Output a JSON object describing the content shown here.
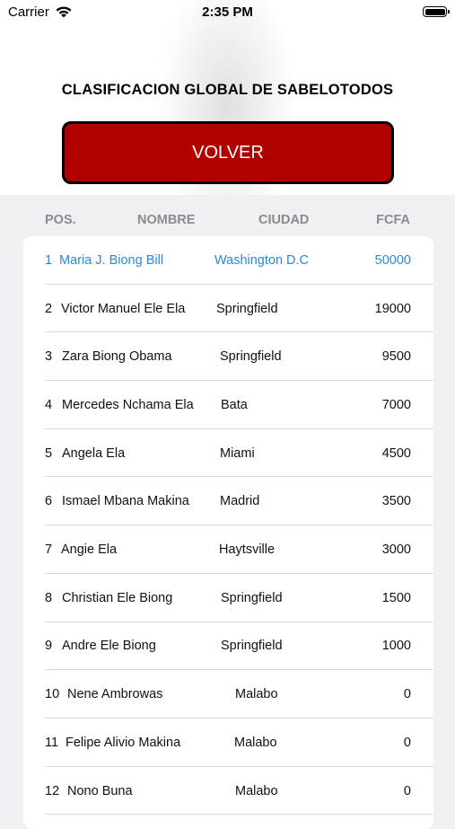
{
  "status_bar": {
    "carrier": "Carrier",
    "time": "2:35 PM"
  },
  "title": "CLASIFICACION GLOBAL DE SABELOTODOS",
  "back_button": "VOLVER",
  "columns": {
    "pos": "POS.",
    "nombre": "NOMBRE",
    "ciudad": "CIUDAD",
    "fcfa": "FCFA"
  },
  "rows": [
    {
      "pos": "1",
      "name": "Maria J. Biong Bill",
      "city": "Washington D.C",
      "score": "50000"
    },
    {
      "pos": "2",
      "name": "Victor Manuel Ele Ela",
      "city": "Springfield",
      "score": "19000"
    },
    {
      "pos": "3",
      "name": "Zara Biong Obama",
      "city": "Springfield",
      "score": "9500"
    },
    {
      "pos": "4",
      "name": "Mercedes Nchama Ela",
      "city": "Bata",
      "score": "7000"
    },
    {
      "pos": "5",
      "name": "Angela Ela",
      "city": "Miami",
      "score": "4500"
    },
    {
      "pos": "6",
      "name": "Ismael Mbana Makina",
      "city": "Madrid",
      "score": "3500"
    },
    {
      "pos": "7",
      "name": "Angie Ela",
      "city": "Haytsville",
      "score": "3000"
    },
    {
      "pos": "8",
      "name": "Christian Ele Biong",
      "city": "Springfield",
      "score": "1500"
    },
    {
      "pos": "9",
      "name": "Andre Ele Biong",
      "city": "Springfield",
      "score": "1000"
    },
    {
      "pos": "10",
      "name": "Nene Ambrowas",
      "city": "Malabo",
      "score": "0"
    },
    {
      "pos": "11",
      "name": "Felipe Alivio Makina",
      "city": "Malabo",
      "score": "0"
    },
    {
      "pos": "12",
      "name": "Nono Buna",
      "city": "Malabo",
      "score": "0"
    }
  ],
  "colors": {
    "highlight_row": "#2f86d6",
    "button": "#b00000"
  }
}
